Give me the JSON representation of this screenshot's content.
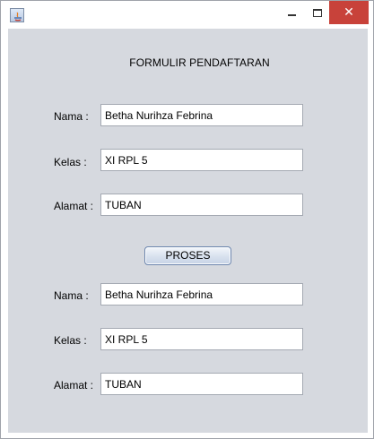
{
  "window": {
    "icon": "java-app-icon",
    "controls": {
      "minimize": "minimize-icon",
      "maximize": "maximize-icon",
      "close": "close-icon"
    }
  },
  "form": {
    "heading": "FORMULIR PENDAFTARAN",
    "input": {
      "nama_label": "Nama :",
      "nama_value": "Betha Nurihza Febrina",
      "kelas_label": "Kelas :",
      "kelas_value": "XI RPL 5",
      "alamat_label": "Alamat :",
      "alamat_value": "TUBAN"
    },
    "button_label": "PROSES",
    "output": {
      "nama_label": "Nama :",
      "nama_value": "Betha Nurihza Febrina",
      "kelas_label": "Kelas :",
      "kelas_value": "XI RPL 5",
      "alamat_label": "Alamat :",
      "alamat_value": "TUBAN"
    }
  },
  "colors": {
    "content_bg": "#d6d9df",
    "close_button": "#c8423a",
    "field_border": "#a4a9b2"
  }
}
